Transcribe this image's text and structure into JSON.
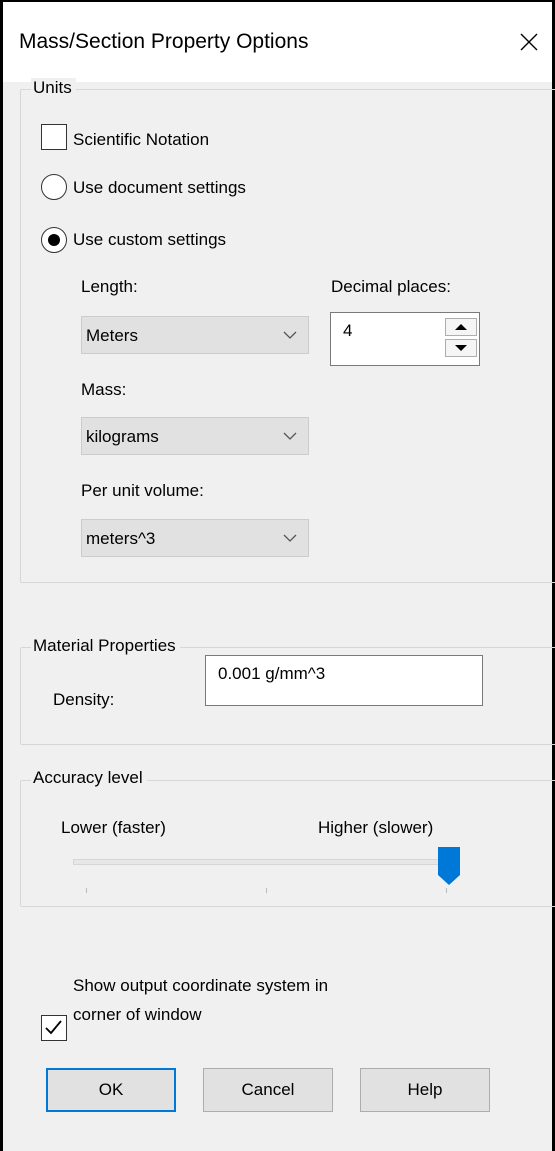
{
  "dialog": {
    "title": "Mass/Section Property Options"
  },
  "units": {
    "group_label": "Units",
    "scientific_notation": {
      "label": "Scientific Notation",
      "checked": false
    },
    "use_document": {
      "label": "Use document settings",
      "selected": false
    },
    "use_custom": {
      "label": "Use custom settings",
      "selected": true
    },
    "length_label": "Length:",
    "length_value": "Meters",
    "decimal_label": "Decimal places:",
    "decimal_value": "4",
    "mass_label": "Mass:",
    "mass_value": "kilograms",
    "volume_label": "Per unit volume:",
    "volume_value": "meters^3"
  },
  "material": {
    "group_label": "Material Properties",
    "density_label": "Density:",
    "density_value": "0.001 g/mm^3"
  },
  "accuracy": {
    "group_label": "Accuracy level",
    "low_label": "Lower (faster)",
    "high_label": "Higher (slower)",
    "level_fraction": 1.0
  },
  "show_coord": {
    "label_line1": "Show output coordinate system in",
    "label_line2": "corner of window",
    "checked": true
  },
  "buttons": {
    "ok": "OK",
    "cancel": "Cancel",
    "help": "Help"
  },
  "colors": {
    "accent": "#0078d7",
    "background": "#f0f0f0"
  }
}
